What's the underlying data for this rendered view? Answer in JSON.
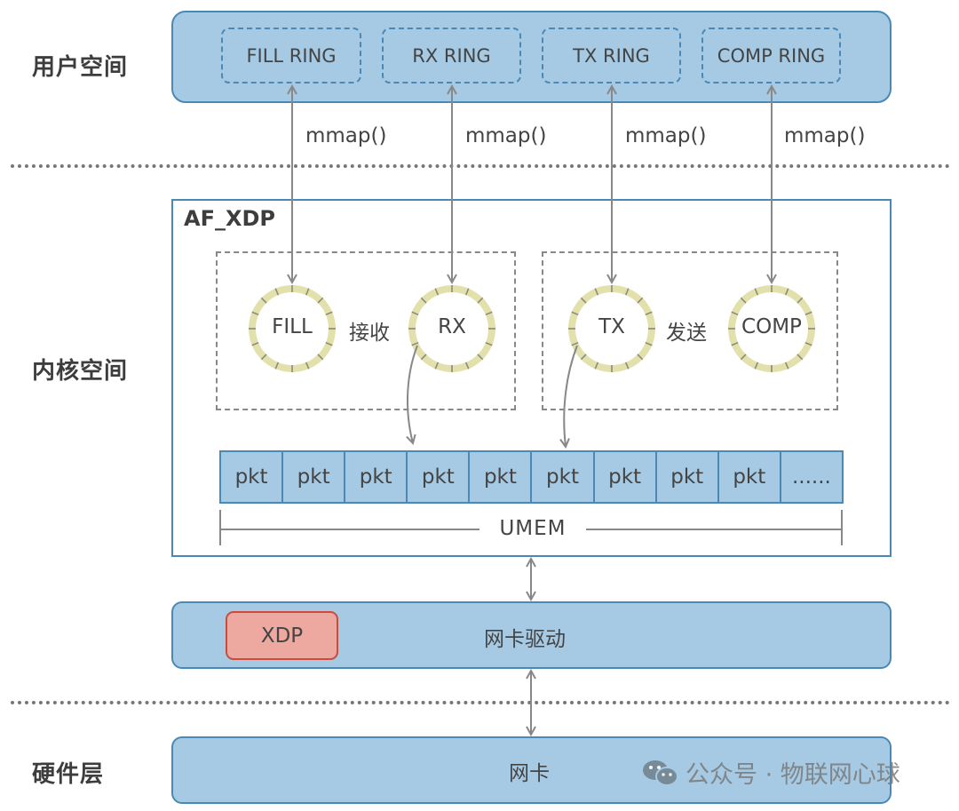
{
  "layers": {
    "user_space": "用户空间",
    "kernel_space": "内核空间",
    "hardware": "硬件层"
  },
  "user_rings": [
    {
      "label": "FILL RING"
    },
    {
      "label": "RX RING"
    },
    {
      "label": "TX RING"
    },
    {
      "label": "COMP RING"
    }
  ],
  "mmap_labels": [
    "mmap()",
    "mmap()",
    "mmap()",
    "mmap()"
  ],
  "af_xdp": {
    "title": "AF_XDP",
    "receive_group": {
      "label": "接收",
      "rings": [
        {
          "label": "FILL"
        },
        {
          "label": "RX"
        }
      ]
    },
    "send_group": {
      "label": "发送",
      "rings": [
        {
          "label": "TX"
        },
        {
          "label": "COMP"
        }
      ]
    },
    "umem": {
      "label": "UMEM",
      "cells": [
        "pkt",
        "pkt",
        "pkt",
        "pkt",
        "pkt",
        "pkt",
        "pkt",
        "pkt",
        "pkt",
        "......"
      ]
    }
  },
  "driver": {
    "label": "网卡驱动",
    "xdp_label": "XDP"
  },
  "nic": {
    "label": "网卡"
  },
  "watermark": {
    "text": "公众号 · 物联网心球",
    "icon": "wechat-icon"
  },
  "colors": {
    "band_fill": "#a6cae3",
    "band_border": "#4a88b6",
    "ring_fill": "#e3e1ab",
    "xdp_fill": "#eda8a0",
    "xdp_border": "#cc4b3f",
    "arrow": "#888888"
  }
}
